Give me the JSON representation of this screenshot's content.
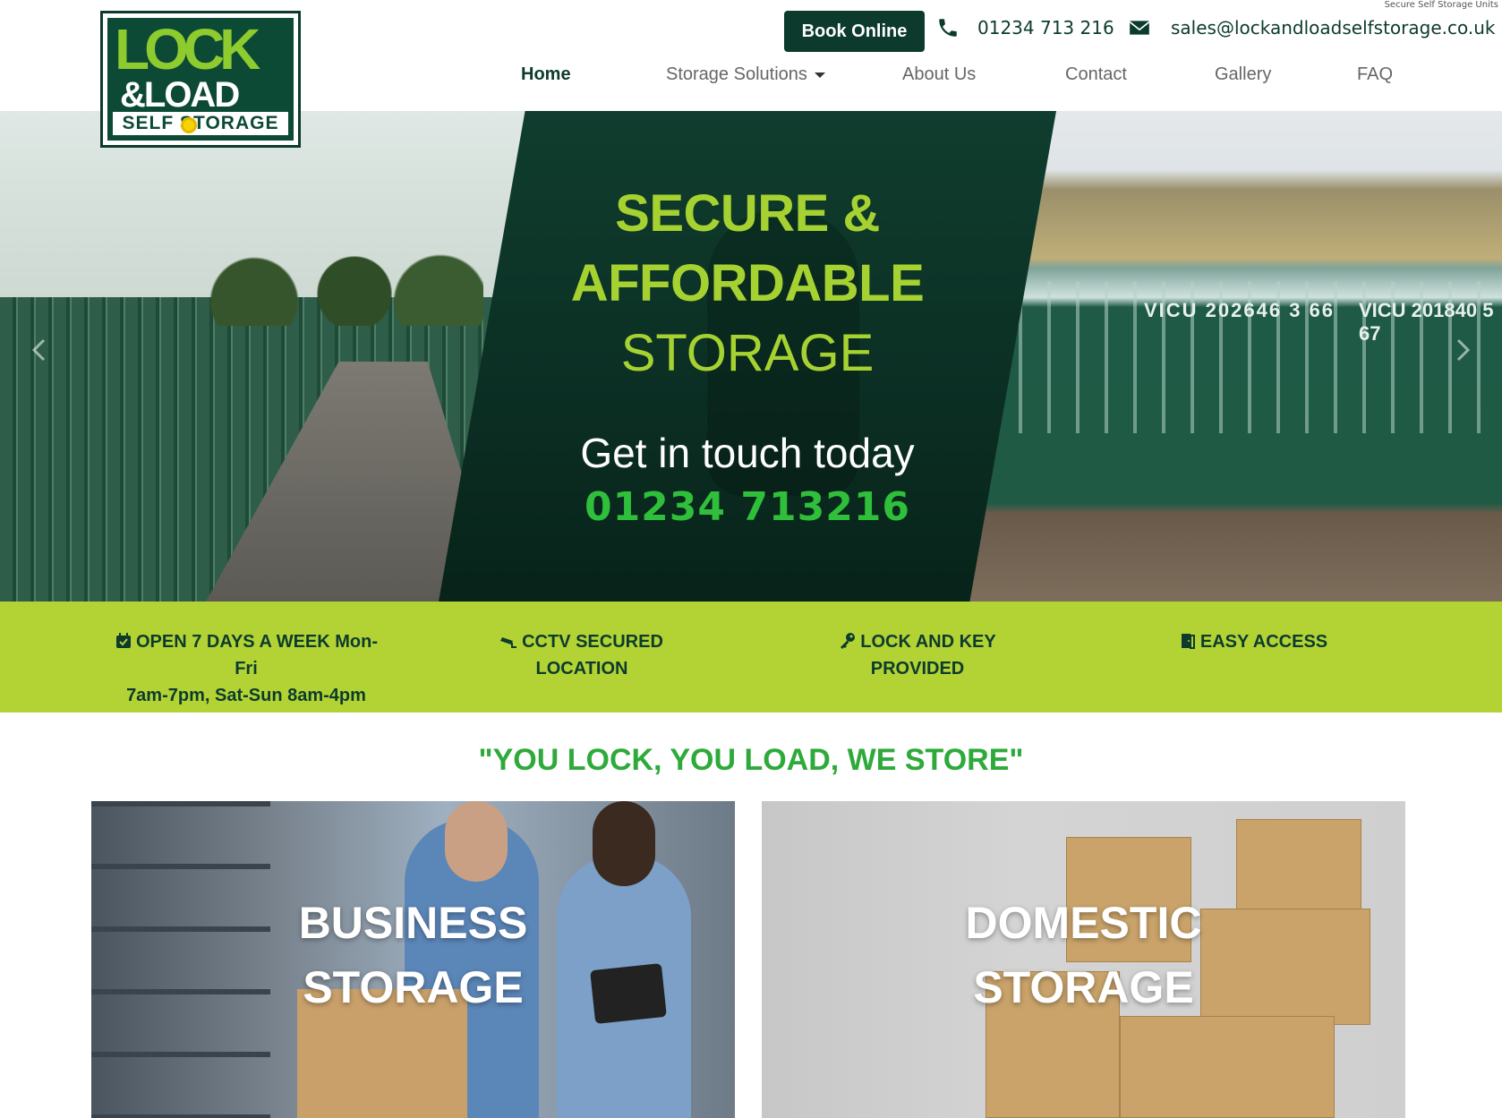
{
  "header": {
    "tagline": "Secure Self Storage Units",
    "logo": {
      "line1": "LOCK",
      "line2": "&LOAD",
      "line3": "SELF STORAGE"
    },
    "book_button": "Book Online",
    "phone": "01234 713 216",
    "email": "sales@lockandloadselfstorage.co.uk"
  },
  "nav": {
    "items": [
      {
        "label": "Home",
        "active": true
      },
      {
        "label": "Storage Solutions",
        "dropdown": true
      },
      {
        "label": "About Us"
      },
      {
        "label": "Contact"
      },
      {
        "label": "Gallery"
      },
      {
        "label": "FAQ"
      }
    ]
  },
  "hero": {
    "title_line1": "SECURE &",
    "title_line2": "AFFORDABLE",
    "title_line3": "STORAGE",
    "cta_text": "Get in touch today",
    "cta_phone": "01234 713216",
    "container_numbers_left": "VICU 202646 3 66",
    "container_numbers_right": "VICU 201840 5 67"
  },
  "features": {
    "items": [
      {
        "label": "OPEN 7 DAYS A WEEK Mon-Fri",
        "label2": "7am-7pm, Sat-Sun 8am-4pm",
        "icon": "calendar-icon"
      },
      {
        "label": "CCTV SECURED LOCATION",
        "icon": "cctv-icon"
      },
      {
        "label": "LOCK AND KEY PROVIDED",
        "icon": "key-icon"
      },
      {
        "label": "EASY ACCESS",
        "icon": "door-icon"
      }
    ]
  },
  "slogan": "\"YOU LOCK, YOU LOAD, WE STORE\"",
  "cards": [
    {
      "line1": "BUSINESS",
      "line2": "STORAGE"
    },
    {
      "line1": "DOMESTIC",
      "line2": "STORAGE"
    }
  ],
  "colors": {
    "brand_dark": "#0c3b2e",
    "brand_lime": "#b3d334",
    "headline_lime": "#a6d231",
    "phone_green": "#2fbf3b",
    "slogan_green": "#2eaa3a"
  }
}
